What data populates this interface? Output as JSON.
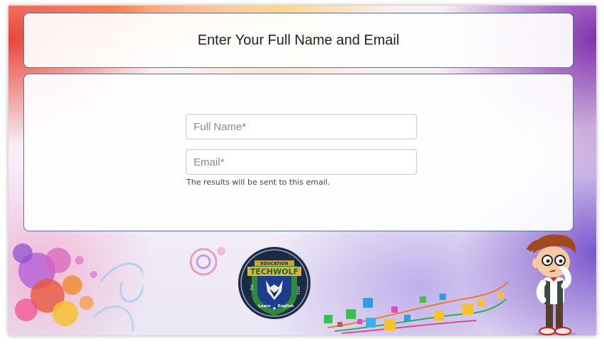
{
  "header": {
    "title": "Enter Your Full Name and Email"
  },
  "form": {
    "name_placeholder": "Full Name*",
    "name_value": "",
    "email_placeholder": "Email*",
    "email_value": "",
    "email_hint": "The results will be sent to this email."
  },
  "logo": {
    "top_text": "EDUCATION",
    "brand": "TECHWOLF",
    "left_text": "Est.",
    "right_text": "2022",
    "bottom_left": "Learn",
    "bottom_right": "English"
  },
  "icons": {
    "mascot": "thinking-boy-icon",
    "decor_left": "colorful-circles-icon",
    "decor_right": "floating-squares-icon"
  },
  "colors": {
    "panel_border": "#5c6f9a",
    "badge_green": "#2f8b3a",
    "badge_blue": "#1c3c8c",
    "badge_gold": "#c8a33b"
  }
}
